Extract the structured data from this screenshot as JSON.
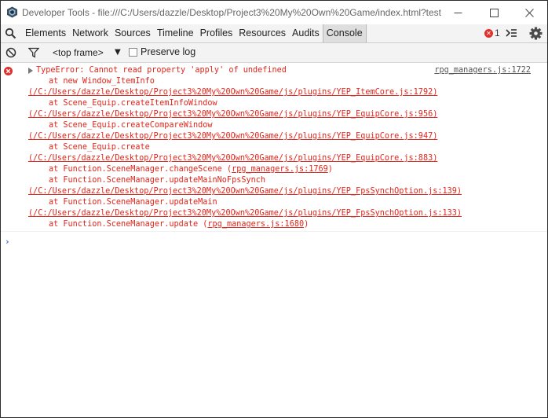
{
  "window": {
    "title": "Developer Tools - file:///C:/Users/dazzle/Desktop/Project3%20My%20Own%20Game/index.html?test"
  },
  "tabs": [
    "Elements",
    "Network",
    "Sources",
    "Timeline",
    "Profiles",
    "Resources",
    "Audits",
    "Console"
  ],
  "active_tab": "Console",
  "error_badge": {
    "count": "1"
  },
  "toolbar": {
    "frame_label": "<top frame>",
    "preserve_log_label": "Preserve log",
    "preserve_log_checked": false
  },
  "error": {
    "message": "TypeError: Cannot read property 'apply' of undefined",
    "source": "rpg_managers.js:1722",
    "stack": [
      {
        "text": "at new Window_ItemInfo",
        "link": "(/C:/Users/dazzle/Desktop/Project3%20My%20Own%20Game/js/plugins/YEP_ItemCore.js:1792)"
      },
      {
        "text": "at Scene_Equip.createItemInfoWindow",
        "link": "(/C:/Users/dazzle/Desktop/Project3%20My%20Own%20Game/js/plugins/YEP_EquipCore.js:956)"
      },
      {
        "text": "at Scene_Equip.createCompareWindow",
        "link": "(/C:/Users/dazzle/Desktop/Project3%20My%20Own%20Game/js/plugins/YEP_EquipCore.js:947)"
      },
      {
        "text": "at Scene_Equip.create",
        "link": "(/C:/Users/dazzle/Desktop/Project3%20My%20Own%20Game/js/plugins/YEP_EquipCore.js:883)"
      },
      {
        "text": "at Function.SceneManager.changeScene",
        "inline_link": "rpg_managers.js:1769"
      },
      {
        "text": "at Function.SceneManager.updateMainNoFpsSynch",
        "link": "(/C:/Users/dazzle/Desktop/Project3%20My%20Own%20Game/js/plugins/YEP_FpsSynchOption.js:139)"
      },
      {
        "text": "at Function.SceneManager.updateMain",
        "link": "(/C:/Users/dazzle/Desktop/Project3%20My%20Own%20Game/js/plugins/YEP_FpsSynchOption.js:133)"
      },
      {
        "text": "at Function.SceneManager.update",
        "inline_link": "rpg_managers.js:1680"
      }
    ]
  },
  "prompt_symbol": "›",
  "colors": {
    "error": "#e0271d",
    "prompt": "#2c6fde",
    "badge": "#e2302d"
  }
}
